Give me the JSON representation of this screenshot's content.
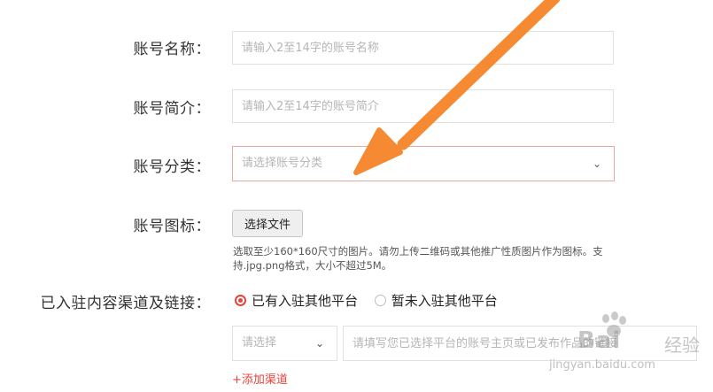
{
  "form": {
    "name": {
      "label": "账号名称：",
      "placeholder": "请输入2至14字的账号名称"
    },
    "intro": {
      "label": "账号简介：",
      "placeholder": "请输入2至14字的账号简介"
    },
    "category": {
      "label": "账号分类：",
      "placeholder": "请选择账号分类"
    },
    "icon": {
      "label": "账号图标：",
      "button": "选择文件",
      "hint": "选取至少160*160尺寸的图片。请勿上传二维码或其他推广性质图片作为图标。支持.jpg.png格式，大小不超过5M。"
    },
    "channels": {
      "label": "已入驻内容渠道及链接：",
      "options": [
        {
          "label": "已有入驻其他平台",
          "checked": true
        },
        {
          "label": "暂未入驻其他平台",
          "checked": false
        }
      ],
      "platform_placeholder": "请选择",
      "url_placeholder": "请填写您已选择平台的账号主页或已发布作品的链接",
      "add_link": "+添加渠道"
    }
  },
  "watermark": {
    "brand": "Bai",
    "brand_cn": "经验",
    "url": "jingyan.baidu.com"
  },
  "colors": {
    "accent": "#e2453c",
    "arrow": "#f58a32"
  },
  "icons": {
    "chevron": "chevron-down-icon",
    "arrow": "annotation-arrow-icon"
  }
}
